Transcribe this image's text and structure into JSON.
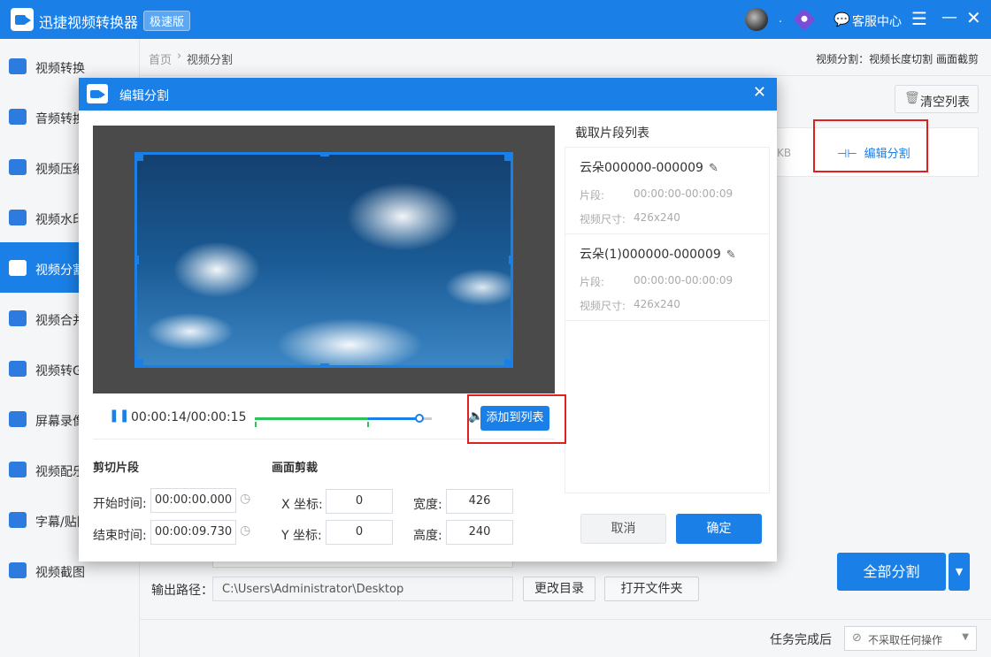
{
  "app": {
    "title": "迅捷视频转换器",
    "edition": "极速版",
    "service_label": "客服中心",
    "user_suffix": "."
  },
  "sidebar": {
    "items": [
      {
        "label": "视频转换"
      },
      {
        "label": "音频转换"
      },
      {
        "label": "视频压缩"
      },
      {
        "label": "视频水印"
      },
      {
        "label": "视频分割",
        "active": true
      },
      {
        "label": "视频合并"
      },
      {
        "label": "视频转GIF"
      },
      {
        "label": "屏幕录像"
      },
      {
        "label": "视频配乐"
      },
      {
        "label": "字幕/贴图"
      },
      {
        "label": "视频截图"
      }
    ]
  },
  "breadcrumb": {
    "home": "首页",
    "sep": "›",
    "current": "视频分割"
  },
  "mode_info": "视频分割：视频长度切割 画面截剪",
  "toolbar": {
    "clear_list": "清空列表"
  },
  "file_row": {
    "size_suffix": "KB",
    "edit_split": "编辑分割"
  },
  "output": {
    "label": "输出路径：",
    "path": "C:\\Users\\Administrator\\Desktop",
    "change_dir": "更改目录",
    "open_folder": "打开文件夹"
  },
  "split_all": "全部分割",
  "footer": {
    "label": "任务完成后",
    "select_value": "不采取任何操作"
  },
  "dialog": {
    "title": "编辑分割",
    "time_display": "00:00:14/00:00:15",
    "playback": {
      "progress": 0.93,
      "selection_end": 0.64
    },
    "add_to_list": "添加到列表",
    "cut": {
      "title": "剪切片段",
      "start_label": "开始时间:",
      "start_value": "00:00:00.000",
      "end_label": "结束时间:",
      "end_value": "00:00:09.730"
    },
    "crop": {
      "title": "画面剪裁",
      "x_label": "X 坐标:",
      "x_value": "0",
      "y_label": "Y 坐标:",
      "y_value": "0",
      "w_label": "宽度:",
      "w_value": "426",
      "h_label": "高度:",
      "h_value": "240"
    },
    "segments_title": "截取片段列表",
    "segments": [
      {
        "name": "云朵000000-000009",
        "seg_label": "片段:",
        "seg_value": "00:00:00-00:00:09",
        "size_label": "视频尺寸:",
        "size_value": "426x240"
      },
      {
        "name": "云朵(1)000000-000009",
        "seg_label": "片段:",
        "seg_value": "00:00:00-00:00:09",
        "size_label": "视频尺寸:",
        "size_value": "426x240"
      }
    ],
    "cancel": "取消",
    "confirm": "确定"
  }
}
